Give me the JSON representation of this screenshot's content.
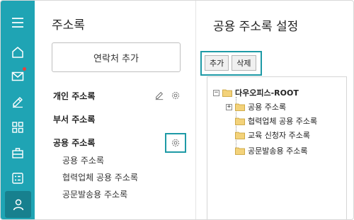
{
  "rail": {
    "items": [
      {
        "icon": "menu-icon"
      },
      {
        "icon": "home-icon"
      },
      {
        "icon": "mail-icon",
        "badge": true
      },
      {
        "icon": "edit-icon"
      },
      {
        "icon": "grid-icon"
      },
      {
        "icon": "briefcase-icon"
      },
      {
        "icon": "form-icon"
      },
      {
        "icon": "user-icon",
        "active": true
      }
    ],
    "color": "#1fa4b4"
  },
  "middle": {
    "title": "주소록",
    "add_contact_label": "연락처 추가",
    "personal_label": "개인 주소록",
    "department_label": "부서 주소록",
    "public_label": "공용 주소록",
    "public_items": [
      "공용 주소록",
      "협력업체 공용 주소록",
      "공문발송용 주소록"
    ]
  },
  "right": {
    "title": "공용 주소록 설정",
    "add_label": "추가",
    "delete_label": "삭제",
    "tree": {
      "root": "다우오피스-ROOT",
      "children": [
        "공용 주소록",
        "협력업체 공용 주소록",
        "교육 신청자 주소록",
        "공문발송용 주소록"
      ]
    }
  },
  "accent": "#1e9aa6"
}
